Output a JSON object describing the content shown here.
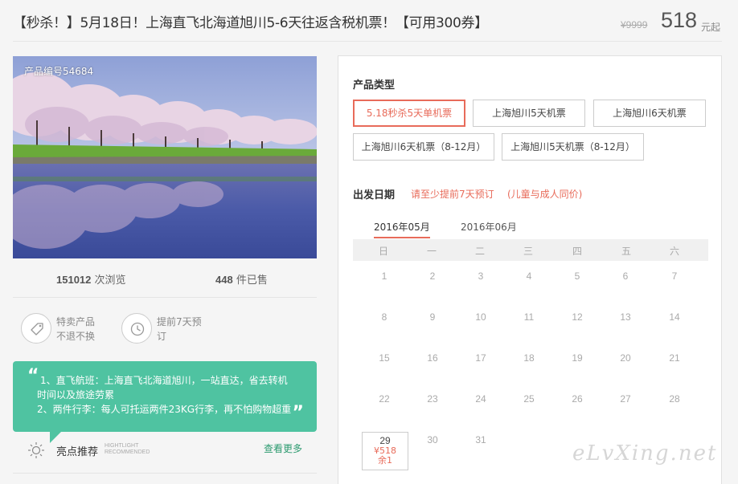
{
  "header": {
    "title": "【秒杀！】5月18日！上海直飞北海道旭川5-6天往返含税机票！【可用300券】",
    "price_old": "¥9999",
    "price_now": "518",
    "price_unit": "元起"
  },
  "gallery": {
    "product_code": "产品编号54684"
  },
  "stats": {
    "views_count": "151012",
    "views_label": "次浏览",
    "sold_count": "448",
    "sold_label": "件已售"
  },
  "features": [
    {
      "icon": "price-tag-icon",
      "line1": "特卖产品",
      "line2": "不退不换"
    },
    {
      "icon": "clock-icon",
      "line1": "提前7天预",
      "line2": "订"
    }
  ],
  "highlights": {
    "lines": [
      "1、直飞航班：上海直飞北海道旭川，一站直达，省去转机",
      "时间以及旅途劳累",
      "2、两件行李：每人可托运两件23KG行李，再不怕购物超重"
    ],
    "label": "亮点推荐",
    "label_en_1": "HIGHTLIGHT",
    "label_en_2": "RECOMMENDED",
    "more": "查看更多"
  },
  "booking": {
    "product_type_label": "产品类型",
    "options": [
      "5.18秒杀5天单机票",
      "上海旭川5天机票",
      "上海旭川6天机票",
      "上海旭川6天机票（8-12月）",
      "上海旭川5天机票（8-12月）"
    ],
    "selected_option": 0,
    "departure_label": "出发日期",
    "tip_advance": "请至少提前7天预订",
    "tip_child": "(儿童与成人同价)",
    "months": [
      "2016年05月",
      "2016年06月"
    ],
    "weekdays": [
      "日",
      "一",
      "二",
      "三",
      "四",
      "五",
      "六"
    ],
    "days": [
      "1",
      "2",
      "3",
      "4",
      "5",
      "6",
      "7",
      "8",
      "9",
      "10",
      "11",
      "12",
      "13",
      "14",
      "15",
      "16",
      "17",
      "18",
      "19",
      "20",
      "21",
      "22",
      "23",
      "24",
      "25",
      "26",
      "27",
      "28",
      "29",
      "30",
      "31"
    ],
    "active_day": {
      "day": "29",
      "price": "¥518",
      "stock": "余1"
    }
  },
  "watermark": "eLvXing.net",
  "colors": {
    "accent": "#e86b5a",
    "highlight_green": "#4fc3a1",
    "link_green": "#2c9a6f"
  }
}
